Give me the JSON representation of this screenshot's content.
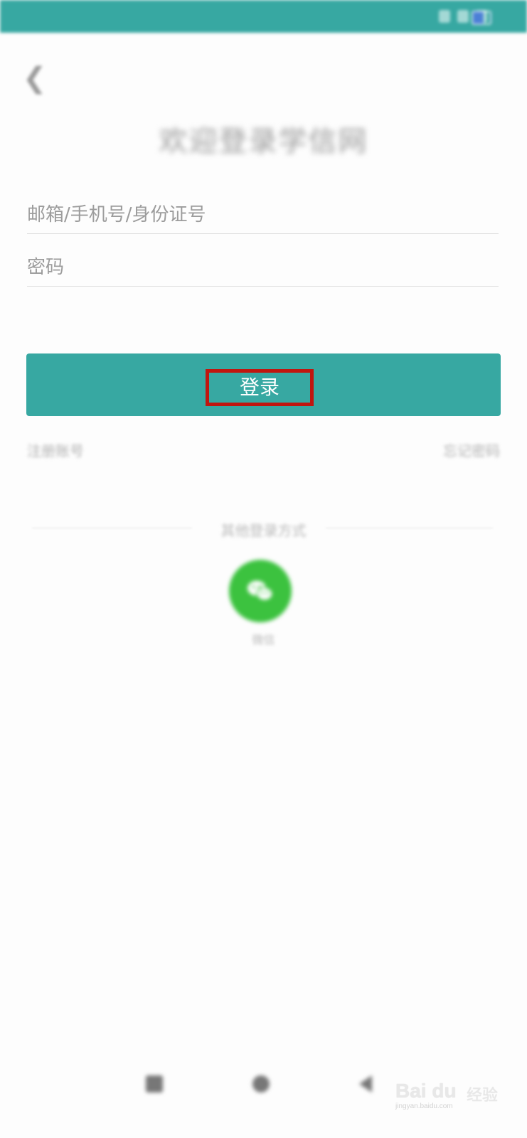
{
  "status_bar": {
    "time": "",
    "right_text": ""
  },
  "header": {
    "back_icon": "chevron-left-icon",
    "title": "欢迎登录学信网"
  },
  "form": {
    "account_placeholder": "邮箱/手机号/身份证号",
    "password_placeholder": "密码",
    "login_label": "登录"
  },
  "links": {
    "register": "注册账号",
    "forgot": "忘记密码"
  },
  "other_login": {
    "label": "其他登录方式",
    "wechat_label": "微信",
    "wechat_icon": "wechat-icon"
  },
  "watermark": {
    "logo": "Bai du",
    "cn": "经验",
    "url": "jingyan.baidu.com"
  },
  "colors": {
    "accent": "#37a8a2",
    "highlight": "#c0160f",
    "wechat": "#3cc23f"
  }
}
